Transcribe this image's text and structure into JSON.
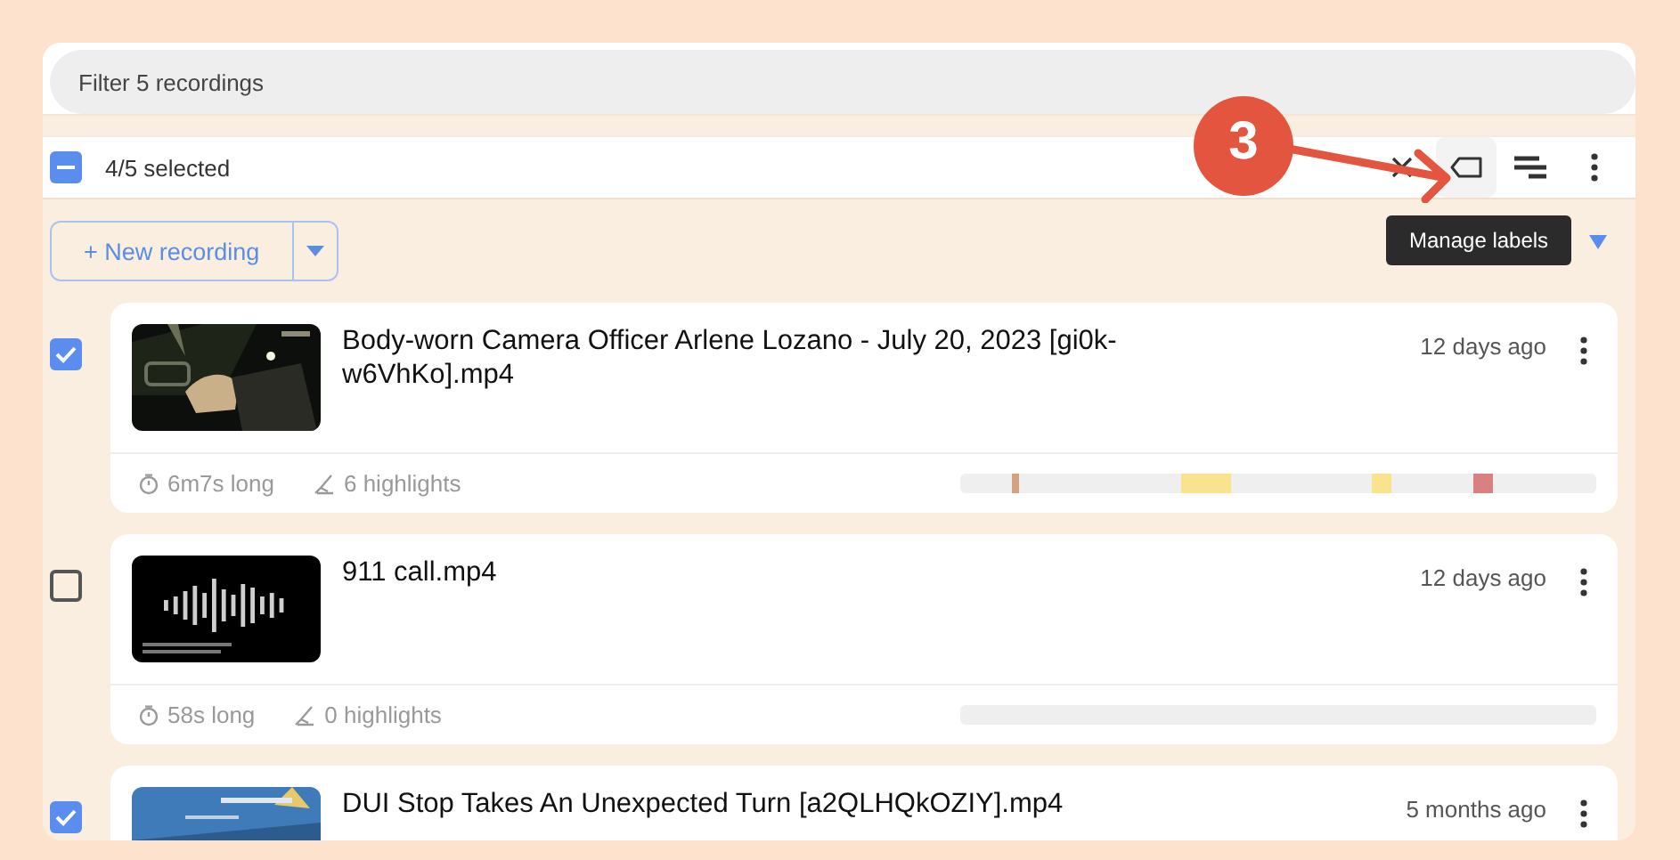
{
  "filter": {
    "placeholder": "Filter 5 recordings"
  },
  "selection": {
    "label": "4/5 selected",
    "indeterminate": true
  },
  "toolbar": [
    {
      "kind": "close",
      "hovered": false
    },
    {
      "kind": "label",
      "hovered": true
    },
    {
      "kind": "lines",
      "hovered": false
    },
    {
      "kind": "more",
      "hovered": false
    }
  ],
  "new_button": {
    "label": "+ New recording"
  },
  "tooltip": {
    "text": "Manage labels"
  },
  "step_marker": {
    "label": "3"
  },
  "recordings": [
    {
      "selected": true,
      "title": "Body-worn Camera Officer Arlene Lozano - July 20, 2023 [gi0k-w6VhKo].mp4",
      "age": "12 days ago",
      "duration": "6m7s long",
      "highlights_count": "6 highlights",
      "highlights": [
        {
          "kind": "tick",
          "color": "#d4a27f"
        },
        {
          "kind": "long",
          "color": "#f7e48c"
        },
        {
          "kind": "short",
          "color": "#f7e48c"
        },
        {
          "kind": "short",
          "color": "#d98080"
        }
      ]
    },
    {
      "selected": false,
      "title": "911 call.mp4",
      "age": "12 days ago",
      "duration": "58s long",
      "highlights_count": "0 highlights"
    },
    {
      "selected": true,
      "title": "DUI Stop Takes An Unexpected Turn [a2QLHQkOZIY].mp4",
      "age": "5 months ago"
    }
  ]
}
